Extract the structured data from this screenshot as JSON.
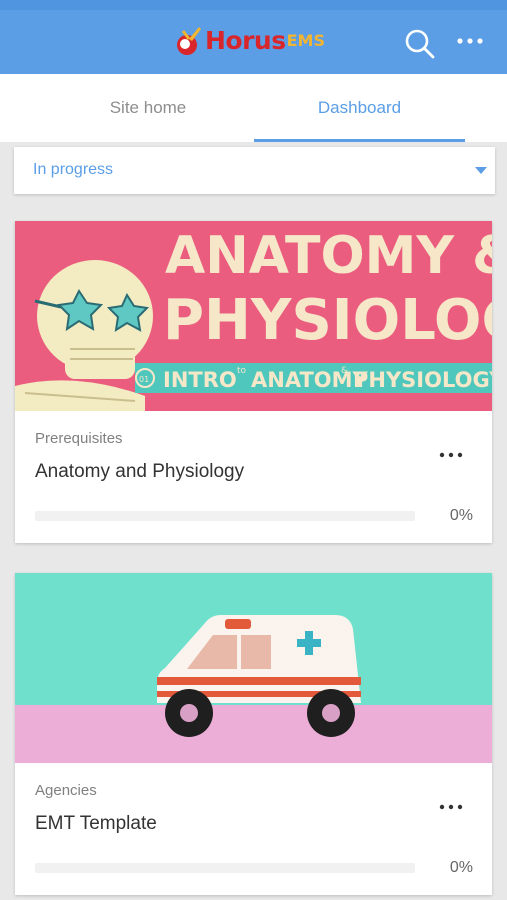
{
  "header": {
    "logo_word": "Horus",
    "logo_suffix": "EMS",
    "search_icon": "search-icon",
    "more_icon": "more-horizontal-icon"
  },
  "tabs": [
    {
      "label": "Site home",
      "active": false
    },
    {
      "label": "Dashboard",
      "active": true
    }
  ],
  "filter": {
    "selected": "In progress",
    "icon": "chevron-down-icon"
  },
  "courses": [
    {
      "category": "Prerequisites",
      "title": "Anatomy and Physiology",
      "progress_label": "0%",
      "progress": 0,
      "image": {
        "headline_1": "ANATOMY &",
        "headline_2": "PHYSIOLOGY",
        "badge": "01",
        "banner_a": "INTRO",
        "banner_to": "to",
        "banner_b": "ANATOMY",
        "banner_amp": "&",
        "banner_c": "PHYSIOLOGY"
      }
    },
    {
      "category": "Agencies",
      "title": "EMT Template",
      "progress_label": "0%",
      "progress": 0
    }
  ],
  "colors": {
    "accent": "#5b9ee6",
    "header_bg": "#5b9ee6",
    "logo_red": "#d8262b",
    "logo_gold": "#f2b531"
  }
}
